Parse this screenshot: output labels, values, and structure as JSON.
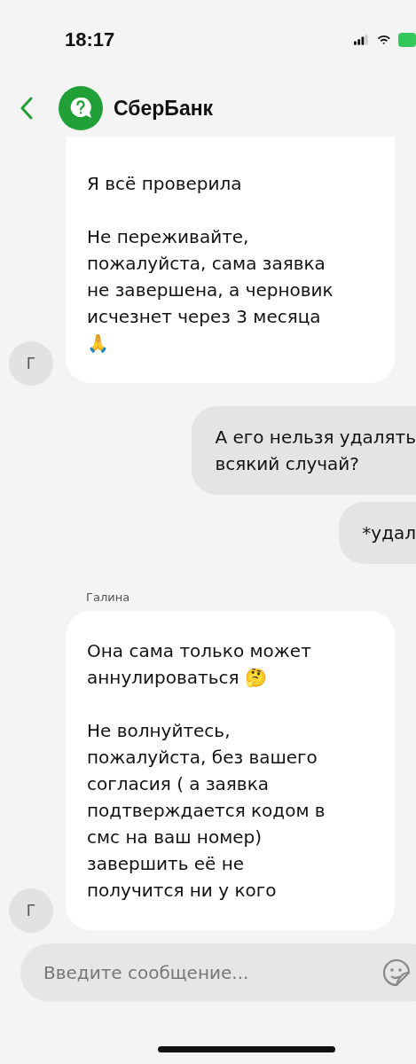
{
  "status_bar": {
    "time": "18:17"
  },
  "header": {
    "title": "СберБанк"
  },
  "messages": [
    {
      "kind": "incoming",
      "avatar": "Г",
      "paragraphs": [
        [
          "Я всё проверила"
        ],
        [
          "Не переживайте,",
          "пожалуйста, сама заявка",
          "не завершена, а черновик",
          "исчезнет через 3 месяца",
          "🙏"
        ]
      ]
    },
    {
      "kind": "outgoing",
      "paragraphs": [
        [
          "А его нельзя удалять",
          "всякий случай?"
        ]
      ]
    },
    {
      "kind": "outgoing",
      "paragraphs": [
        [
          "*удал"
        ]
      ]
    },
    {
      "kind": "incoming",
      "author": "Галина",
      "avatar": "Г",
      "paragraphs": [
        [
          "Она сама только может",
          "аннулироваться 🤔"
        ],
        [
          "Не волнуйтесь,",
          "пожалуйста, без вашего",
          "согласия ( а заявка",
          "подтверждается кодом в",
          "смс на ваш номер)",
          "завершить её не",
          "получится ни у кого"
        ]
      ]
    }
  ],
  "composer": {
    "placeholder": "Введите сообщение..."
  }
}
